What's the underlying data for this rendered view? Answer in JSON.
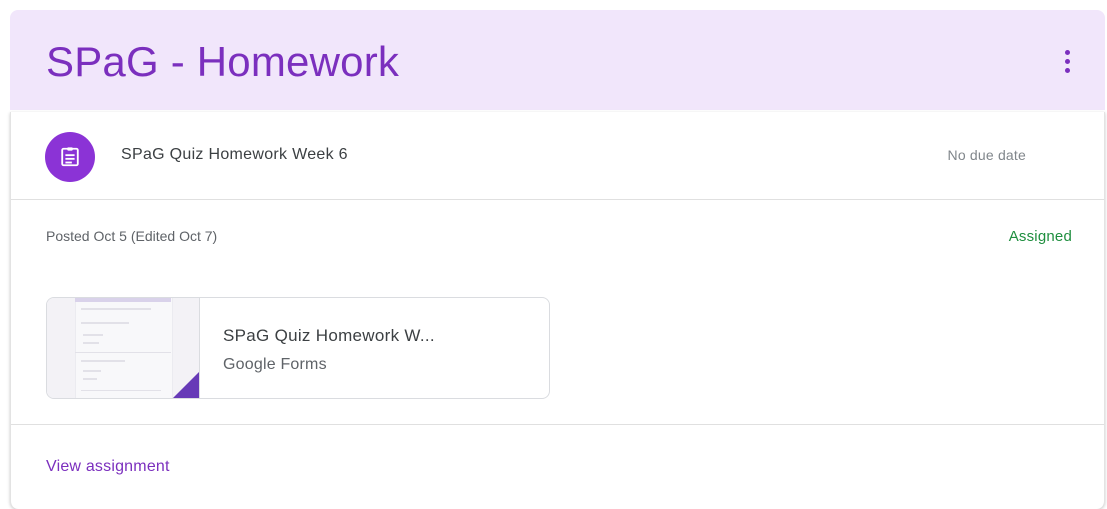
{
  "topic": {
    "title": "SPaG - Homework",
    "more_icon": "more-vert-icon"
  },
  "assignment": {
    "icon": "assignment-icon",
    "title": "SPaG Quiz Homework Week 6",
    "due": "No due date",
    "posted": "Posted Oct 5 (Edited Oct 7)",
    "status": "Assigned",
    "attachment": {
      "title": "SPaG Quiz Homework W...",
      "type": "Google Forms",
      "icon": "google-forms-icon"
    },
    "view_link": "View assignment"
  },
  "colors": {
    "accent": "#7b2fbe",
    "header_bg": "#f1e6fb",
    "status_green": "#1e8e3e",
    "icon_bg": "#8b33d6",
    "forms_purple": "#673ab7"
  }
}
